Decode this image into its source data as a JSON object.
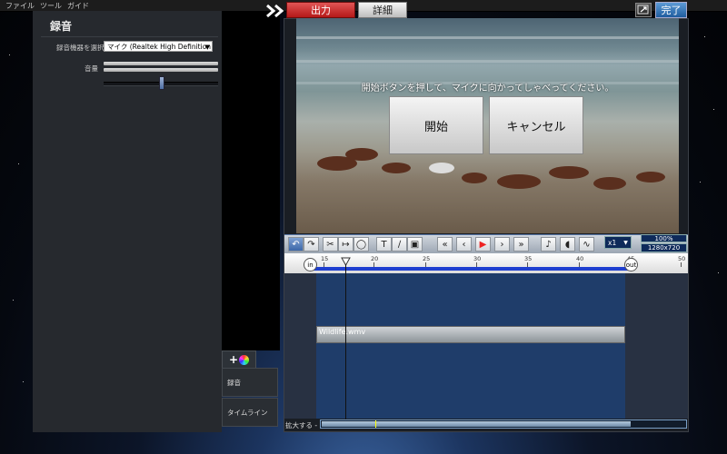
{
  "menubar": {
    "items": [
      "ファイル",
      "ツール",
      "ガイド"
    ]
  },
  "recording_panel": {
    "title": "録音",
    "device_label": "録音機器を選択",
    "device_value": "マイク (Realtek High Definition Au",
    "volume_label": "音量"
  },
  "side_tabs": {
    "recording": "録音",
    "timeline": "タイムライン"
  },
  "top_tabs": {
    "output": "出力",
    "detail": "詳細"
  },
  "done_label": "完了",
  "preview": {
    "prompt": "開始ボタンを押して、マイクに向かってしゃべってください。",
    "start_label": "開始",
    "cancel_label": "キャンセル"
  },
  "toolbar": {
    "speed": "x1",
    "zoom": "100%",
    "resolution": "1280x720"
  },
  "ruler": {
    "ticks": [
      "15",
      "20",
      "25",
      "30",
      "35",
      "40",
      "45",
      "50"
    ],
    "in_label": "in",
    "out_label": "out"
  },
  "clip": {
    "name": "Wildlife.wmv"
  },
  "bottom": {
    "zoom_label": "拡大する"
  },
  "colors": {
    "accent_red": "#c62828",
    "accent_blue": "#1f5c9e",
    "ruler_blue": "#1f3fd0"
  }
}
